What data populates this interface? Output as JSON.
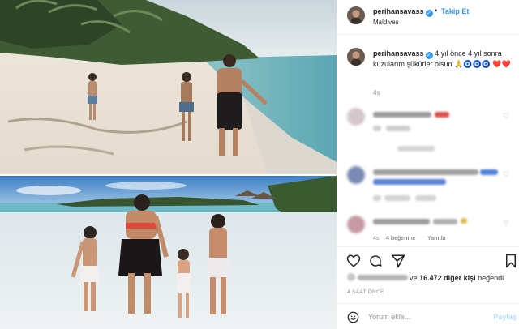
{
  "post": {
    "username": "perihansavass",
    "verified_badge": "✓",
    "separator": "•",
    "follow_label": "Takip Et",
    "location": "Maldives",
    "caption_text": "4 yıl önce 4 yıl sonra kuzularım şükürler olsun 🙏🧿🧿🧿 ❤️❤️",
    "caption_time": "4s",
    "likes_prefix": "ve",
    "likes_count": "16.472 diğer kişi",
    "likes_suffix": "beğendi",
    "post_time": "4 SAAT ÖNCE",
    "comment_placeholder": "Yorum ekle...",
    "post_button": "Paylaş"
  },
  "comments": [
    {
      "meta": ""
    },
    {
      "meta": ""
    },
    {
      "meta_time": "4s",
      "meta_likes": "4 beğenme",
      "meta_reply": "Yanıtla"
    }
  ],
  "icons": {
    "heart": "heart-icon",
    "comment": "comment-icon",
    "share": "share-icon",
    "save": "bookmark-icon",
    "emoji": "emoji-icon"
  },
  "colors": {
    "accent": "#3897f0",
    "text": "#262626",
    "muted": "#8e8e8e",
    "border": "#efefef"
  }
}
